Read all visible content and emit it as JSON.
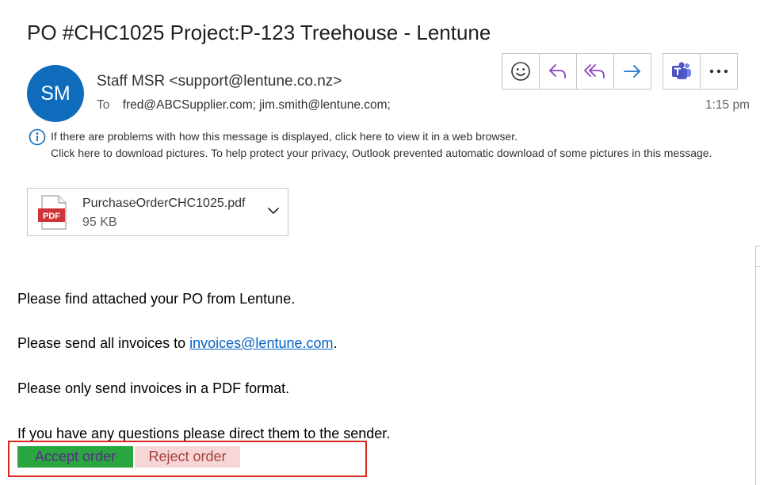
{
  "message": {
    "subject": "PO #CHC1025 Project:P-123 Treehouse - Lentune",
    "avatar_initials": "SM",
    "sender": "Staff MSR <support@lentune.co.nz>",
    "to_label": "To",
    "to_addresses": "fred@ABCSupplier.com; jim.smith@lentune.com;",
    "time": "1:15 pm"
  },
  "toolbar": {
    "icons": [
      "emoji-icon",
      "reply-icon",
      "reply-all-icon",
      "forward-icon",
      "teams-icon",
      "more-icon"
    ]
  },
  "infobar": {
    "line1": "If there are problems with how this message is displayed, click here to view it in a web browser.",
    "line2": "Click here to download pictures. To help protect your privacy, Outlook prevented automatic download of some pictures in this message."
  },
  "attachment": {
    "filename": "PurchaseOrderCHC1025.pdf",
    "size": "95 KB",
    "badge": "PDF"
  },
  "body": {
    "p1": "Please find attached your PO from Lentune.",
    "p2_prefix": "Please send all invoices to ",
    "p2_link": "invoices@lentune.com",
    "p2_suffix": ".",
    "p3": "Please only send invoices in a PDF format.",
    "p4": "If you have any questions please direct them to the sender."
  },
  "actions": {
    "accept_label": "Accept order",
    "reject_label": "Reject order"
  },
  "colors": {
    "avatar": "#0f6cbd",
    "reply_purple": "#8a3fb8",
    "forward_blue": "#1f6fd1",
    "accept_bg": "#2aa640",
    "reject_bg": "#f6d6d6",
    "highlight_border": "#d9261c",
    "link": "#0563c1"
  }
}
